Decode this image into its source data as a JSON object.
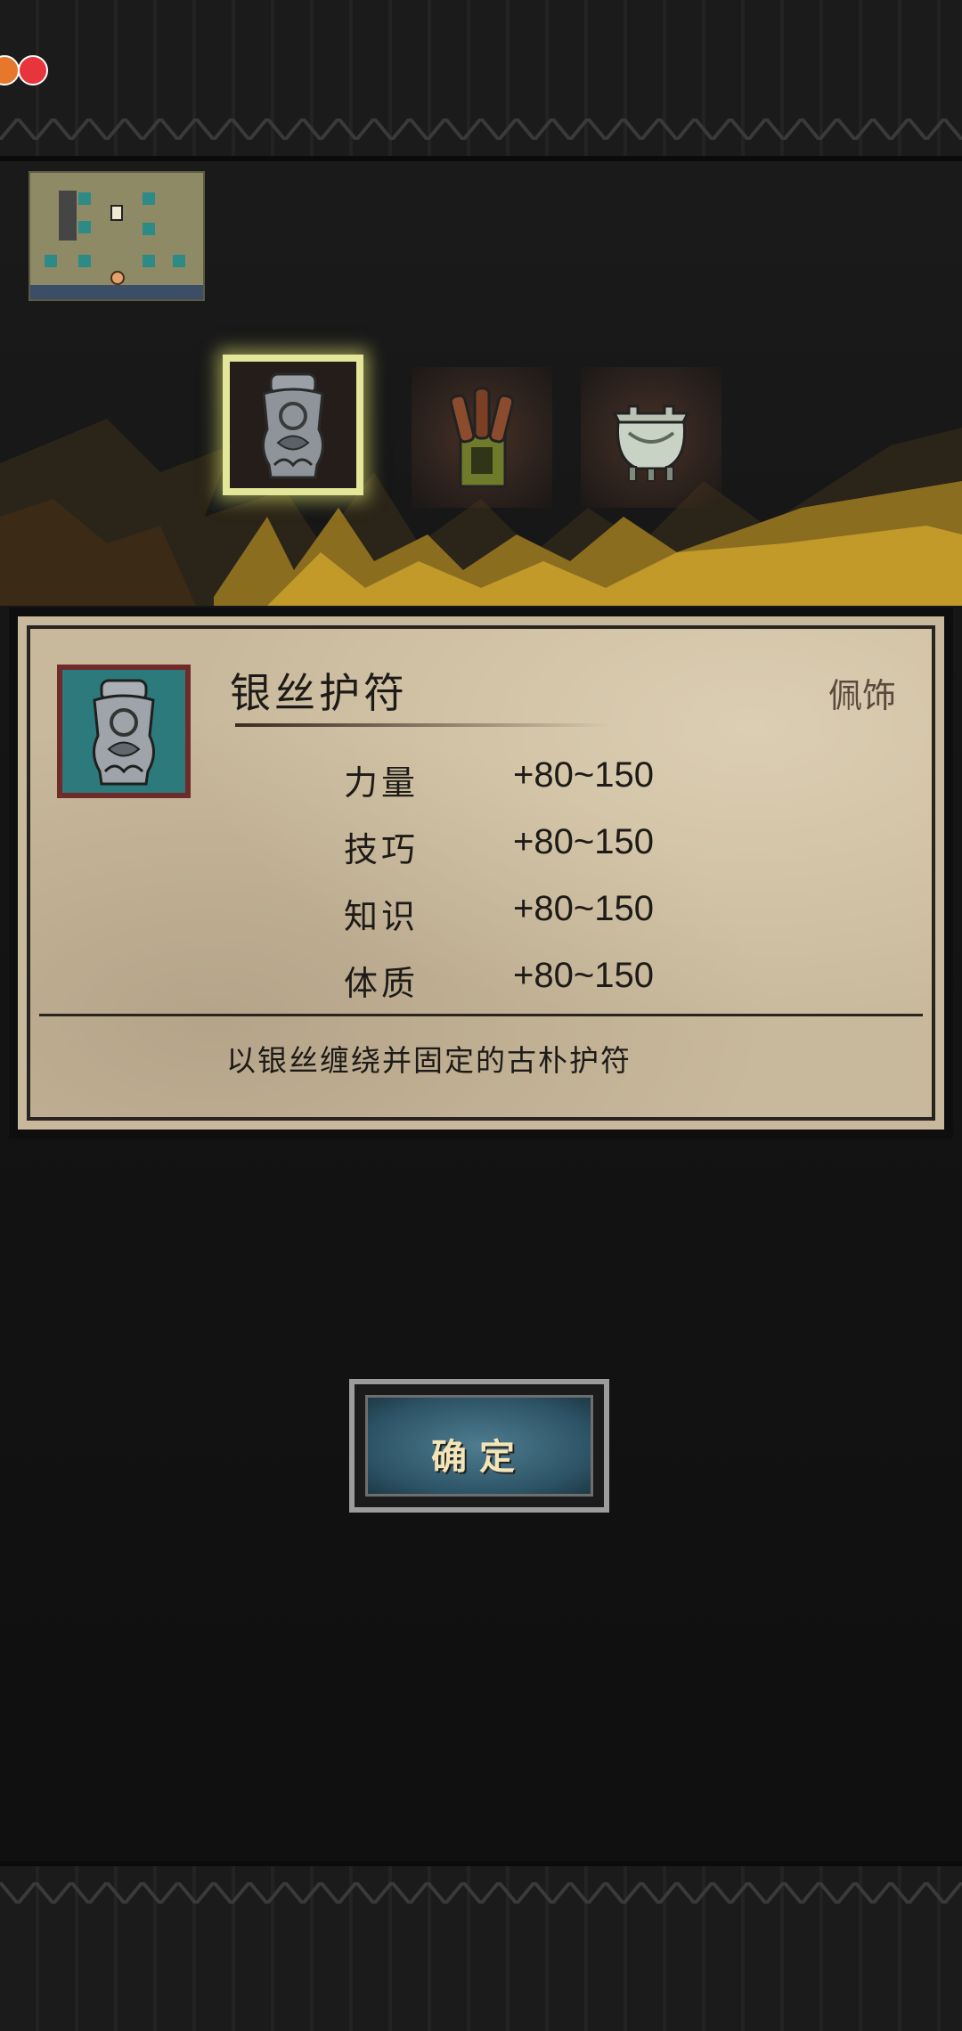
{
  "hud": {
    "status_icons": [
      "orange-status-dot",
      "red-status-dot"
    ]
  },
  "item_slots": [
    {
      "item": "silver-amulet",
      "selected": true
    },
    {
      "item": "scroll-bundle",
      "selected": false
    },
    {
      "item": "bronze-cauldron",
      "selected": false
    }
  ],
  "detail": {
    "name": "银丝护符",
    "type": "佩饰",
    "stats": [
      {
        "label": "力量",
        "value": "+80~150"
      },
      {
        "label": "技巧",
        "value": "+80~150"
      },
      {
        "label": "知识",
        "value": "+80~150"
      },
      {
        "label": "体质",
        "value": "+80~150"
      }
    ],
    "description": "以银丝缠绕并固定的古朴护符"
  },
  "confirm_label": "确定",
  "colors": {
    "selection_glow": "#e4e69a",
    "icon_background": "#2d7a7c",
    "button_fill": "#2d5466",
    "panel_paper": "#c9b99c"
  }
}
